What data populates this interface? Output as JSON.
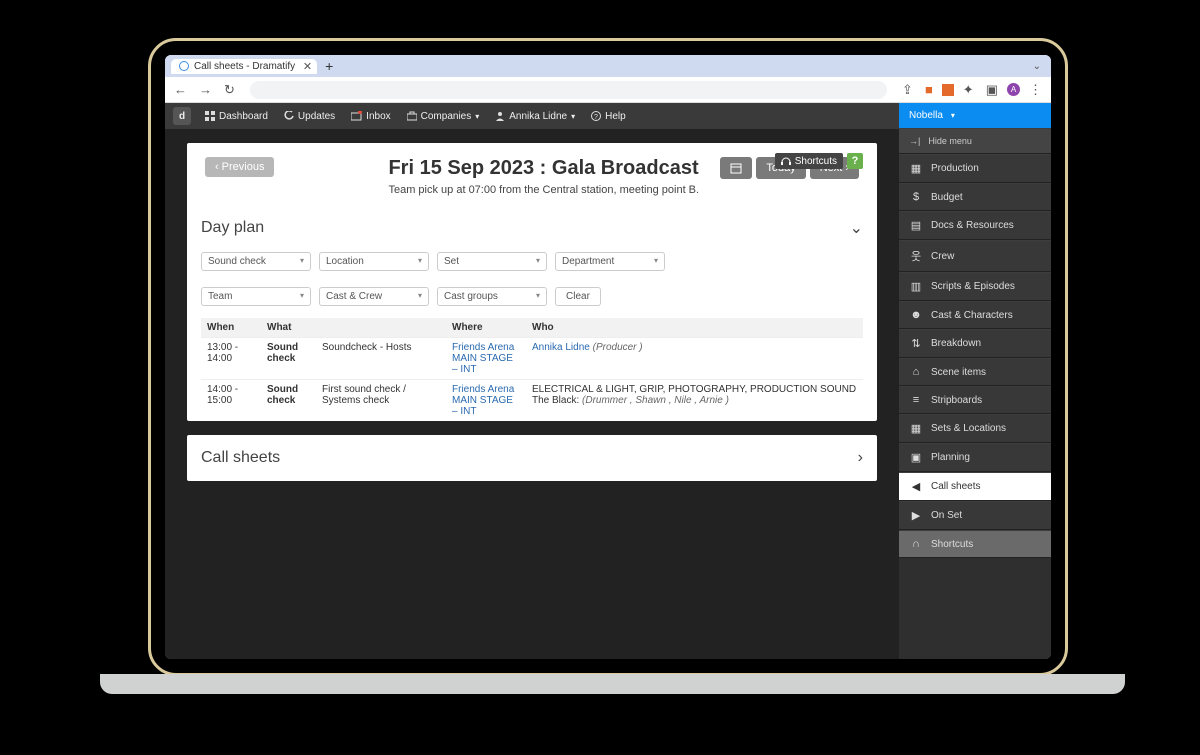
{
  "browser": {
    "tab_title": "Call sheets - Dramatify",
    "icons": {
      "back": "←",
      "forward": "→",
      "reload": "↻",
      "share": "⇪",
      "ext1": "■",
      "puzzle": "✦",
      "panel": "▣",
      "profile": "A",
      "menu": "⋮",
      "caret": "⌄",
      "plus": "+",
      "close": "✕"
    }
  },
  "topnav": {
    "logo": "d",
    "items": [
      "Dashboard",
      "Updates",
      "Inbox",
      "Companies",
      "Annika Lidne",
      "Help"
    ]
  },
  "ribbon": {
    "shortcuts": "Shortcuts",
    "question": "?"
  },
  "header": {
    "previous": "Previous",
    "title": "Fri 15 Sep 2023 : Gala Broadcast",
    "subtitle": "Team pick up at 07:00 from the Central station, meeting point B.",
    "today": "Today",
    "next": "Next"
  },
  "sections": {
    "dayplan": "Day plan",
    "callsheets": "Call sheets"
  },
  "filters": {
    "row1": [
      "Sound check",
      "Location",
      "Set",
      "Department"
    ],
    "row2": [
      "Team",
      "Cast & Crew",
      "Cast groups"
    ],
    "clear": "Clear"
  },
  "table": {
    "columns": [
      "When",
      "What",
      "",
      "Where",
      "Who"
    ],
    "rows": [
      {
        "when": "13:00 - 14:00",
        "what": "Sound check",
        "desc": "Soundcheck - Hosts",
        "where": [
          "Friends Arena",
          "MAIN STAGE – INT"
        ],
        "who_link": "Annika Lidne",
        "who_role": "(Producer )"
      },
      {
        "when": "14:00 - 15:00",
        "what": "Sound check",
        "desc": "First sound check / Systems check",
        "where": [
          "Friends Arena",
          "MAIN STAGE – INT"
        ],
        "who_depts": "ELECTRICAL & LIGHT, GRIP, PHOTOGRAPHY, PRODUCTION SOUND",
        "who_group": "The Black:",
        "who_names": "(Drummer , Shawn , Nile , Arnie )"
      }
    ]
  },
  "sidebar": {
    "project": "Nobella",
    "hide": "Hide menu",
    "items": [
      "Production",
      "Budget",
      "Docs & Resources",
      "Crew",
      "Scripts & Episodes",
      "Cast & Characters",
      "Breakdown",
      "Scene items",
      "Stripboards",
      "Sets & Locations",
      "Planning",
      "Call sheets",
      "On Set",
      "Shortcuts"
    ]
  }
}
